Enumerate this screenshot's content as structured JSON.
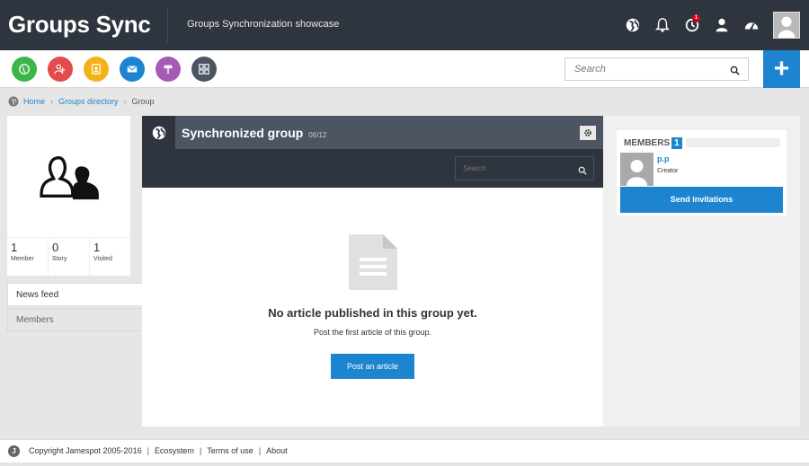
{
  "header": {
    "brand": "Groups Sync",
    "subtitle": "Groups Synchronization showcase",
    "icons": [
      "globe-icon",
      "bell-icon",
      "clock-icon",
      "user-icon",
      "dashboard-icon"
    ],
    "notification_count": "1"
  },
  "appbar": {
    "apps": [
      {
        "name": "globe-app",
        "color": "#3cb54a"
      },
      {
        "name": "people-app",
        "color": "#e24b4b"
      },
      {
        "name": "contacts-app",
        "color": "#f3b218"
      },
      {
        "name": "mail-app",
        "color": "#1d84d0"
      },
      {
        "name": "signpost-app",
        "color": "#a55bb4"
      },
      {
        "name": "apps-grid-app",
        "color": "#4d5563"
      }
    ],
    "search_placeholder": "Search",
    "plus_label": "+"
  },
  "breadcrumb": {
    "home": "Home",
    "directory": "Groups directory",
    "current": "Group"
  },
  "profile": {
    "stats": [
      {
        "num": "1",
        "label": "Member"
      },
      {
        "num": "0",
        "label": "Story"
      },
      {
        "num": "1",
        "label": "Visited"
      }
    ]
  },
  "tabs": {
    "news_feed": "News feed",
    "members": "Members"
  },
  "panel": {
    "title": "Synchronized group",
    "date": "06/12",
    "search_placeholder": "Search",
    "empty_title": "No article published in this group yet.",
    "empty_sub": "Post the first article of this group.",
    "post_button": "Post an article"
  },
  "members": {
    "label": "MEMBERS",
    "count": "1",
    "member_name": "p.p",
    "member_role": "Creator",
    "send_button": "Send invitations"
  },
  "footer": {
    "copyright": "Copyright Jamespot 2005-2016",
    "ecosystem": "Ecosystem",
    "terms": "Terms of use",
    "about": "About"
  },
  "colors": {
    "dark": "#2f353f",
    "accent": "#1d84d0"
  }
}
